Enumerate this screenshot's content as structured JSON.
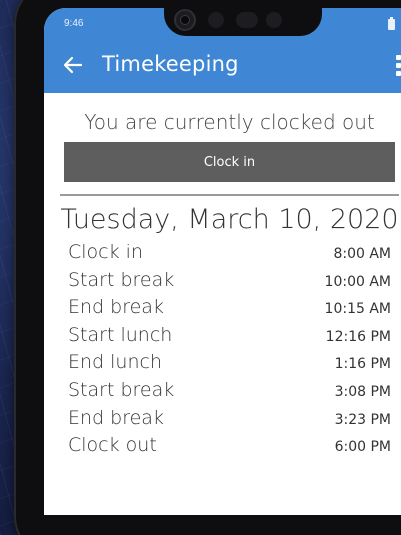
{
  "status_bar": {
    "time": "9:46"
  },
  "app_bar": {
    "title": "Timekeeping"
  },
  "status_message": "You are currently clocked out",
  "clock_button_label": "Clock in",
  "date": "Tuesday, March 10, 2020",
  "entries": [
    {
      "label": "Clock in",
      "time": "8:00 AM"
    },
    {
      "label": "Start break",
      "time": "10:00 AM"
    },
    {
      "label": "End break",
      "time": "10:15 AM"
    },
    {
      "label": "Start lunch",
      "time": "12:16 PM"
    },
    {
      "label": "End lunch",
      "time": "1:16 PM"
    },
    {
      "label": "Start break",
      "time": "3:08 PM"
    },
    {
      "label": "End break",
      "time": "3:23 PM"
    },
    {
      "label": "Clock out",
      "time": "6:00 PM"
    }
  ],
  "colors": {
    "app_bar": "#3f87d4",
    "button": "#5e5e5e",
    "background": "#1b2650"
  },
  "icons": {
    "back": "arrow-left-icon",
    "menu": "more-vertical-icon",
    "battery": "battery-icon",
    "camera": "camera-icon"
  }
}
